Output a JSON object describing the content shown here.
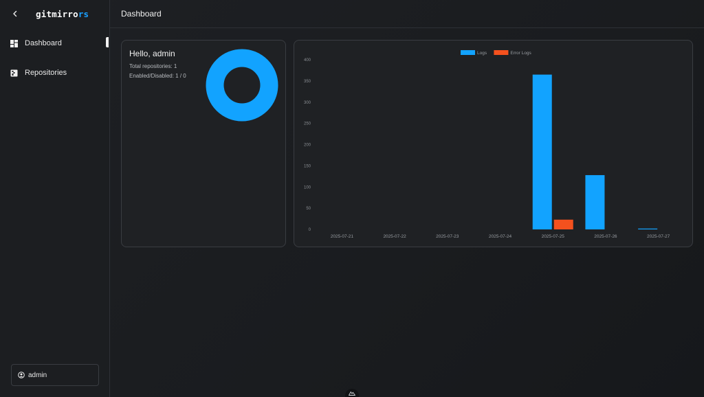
{
  "sidebar": {
    "logo_main": "gitmirro",
    "logo_accent": "rs",
    "items": [
      {
        "label": "Dashboard",
        "icon": "dashboard-icon",
        "active": true
      },
      {
        "label": "Repositories",
        "icon": "repository-icon",
        "active": false
      }
    ],
    "user": {
      "name": "admin",
      "icon": "user-circle-icon"
    }
  },
  "header": {
    "title": "Dashboard"
  },
  "hello": {
    "title": "Hello, admin",
    "total_repositories": "Total repositories: 1",
    "enabled_disabled": "Enabled/Disabled: 1 / 0",
    "donut": {
      "enabled": 1,
      "disabled": 0,
      "color": "#12a3ff"
    }
  },
  "chart_data": {
    "type": "bar",
    "categories": [
      "2025-07-21",
      "2025-07-22",
      "2025-07-23",
      "2025-07-24",
      "2025-07-25",
      "2025-07-26",
      "2025-07-27"
    ],
    "series": [
      {
        "name": "Logs",
        "color": "#12a3ff",
        "values": [
          0,
          0,
          0,
          0,
          365,
          128,
          2
        ]
      },
      {
        "name": "Error Logs",
        "color": "#f4511e",
        "values": [
          0,
          0,
          0,
          0,
          23,
          0,
          0
        ]
      }
    ],
    "ylim": [
      0,
      400
    ],
    "yticks": [
      0,
      50,
      100,
      150,
      200,
      250,
      300,
      350,
      400
    ],
    "legend_position": "top-center",
    "grid": false
  },
  "colors": {
    "accent": "#12a3ff",
    "error": "#f4511e",
    "background": "#1c1e21"
  }
}
